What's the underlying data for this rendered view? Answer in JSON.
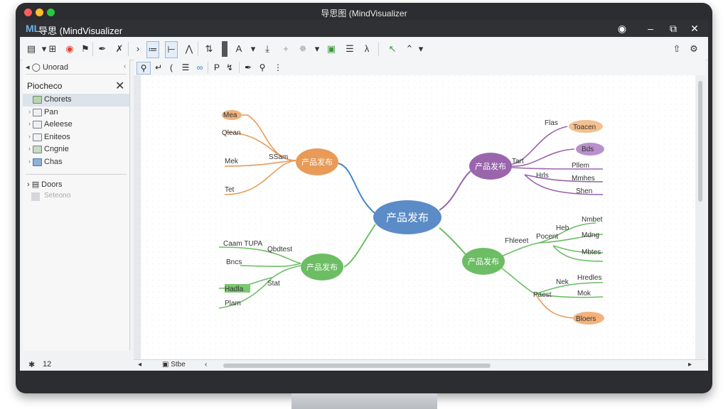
{
  "os_title": "导思图 (MindVisualizer",
  "app": {
    "logo": "ML",
    "title": "导思 (MindVisualizer"
  },
  "sidebar": {
    "header": "Unorad",
    "panel_title": "Piocheco",
    "items": [
      {
        "label": "Chorets",
        "selected": true
      },
      {
        "label": "Pan"
      },
      {
        "label": "Aeleese"
      },
      {
        "label": "Eniteos"
      },
      {
        "label": "Cngnie"
      },
      {
        "label": "Chas"
      }
    ],
    "docs_label": "Doors",
    "grey_label": "Seteono",
    "status_count": "12"
  },
  "editor": {
    "bottom_tab": "Stbe"
  },
  "mindmap": {
    "central": {
      "label": "产品发布",
      "color": "#5b8cc7"
    },
    "branches": [
      {
        "label": "产品发布",
        "color": "#e99a57",
        "side": "left",
        "connector": "SSam",
        "leaves": [
          "Mea",
          "Qlean",
          "Mek",
          "Tet"
        ]
      },
      {
        "label": "产品发布",
        "color": "#9a65ad",
        "side": "right",
        "connector": "Tart",
        "leaves": [
          "Toacen",
          "Bds",
          "Pllem",
          "Mmhes",
          "Shen"
        ],
        "leaf_prefixes": [
          "Flas",
          "Hrls"
        ]
      },
      {
        "label": "产品发布",
        "color": "#6cbd64",
        "side": "left",
        "connector": "Qbdtest",
        "leaves": [
          "Caam TUPA",
          "Bncs",
          "Hadla",
          "Plam"
        ],
        "sub_connector": "Stat"
      },
      {
        "label": "产品发布",
        "color": "#6cbd64",
        "side": "right",
        "connector": "Fhleeet",
        "leaves": [
          "Nmbet",
          "Mdng",
          "Mbtes",
          "Hredles",
          "Mok",
          "Bloers"
        ],
        "sub_connectors": [
          "Pocent",
          "Paest",
          "Nek",
          "Heb"
        ]
      }
    ]
  }
}
